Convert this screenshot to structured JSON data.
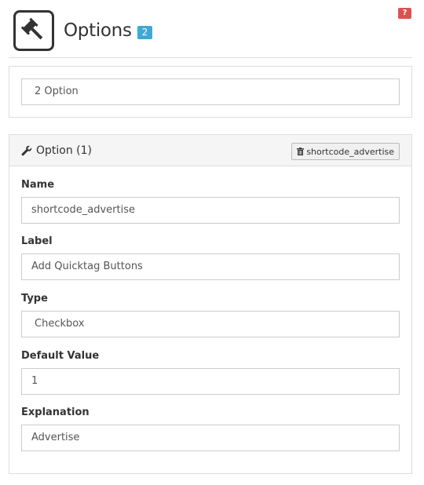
{
  "help": {
    "label": "?"
  },
  "header": {
    "icon": "gavel-icon",
    "title": "Options",
    "count": "2"
  },
  "selector": {
    "value": "2 Option"
  },
  "option": {
    "heading": "Option (1)",
    "remove_label": "shortcode_advertise",
    "fields": {
      "name": {
        "label": "Name",
        "value": "shortcode_advertise"
      },
      "label": {
        "label": "Label",
        "value": "Add Quicktag Buttons"
      },
      "type": {
        "label": "Type",
        "value": "Checkbox"
      },
      "default": {
        "label": "Default Value",
        "value": "1"
      },
      "explanation": {
        "label": "Explanation",
        "value": "Advertise"
      }
    }
  },
  "colors": {
    "help_badge": "#d9534f",
    "count_badge": "#3fa9d4",
    "panel_heading": "#f5f5f5",
    "border": "#dddddd"
  }
}
